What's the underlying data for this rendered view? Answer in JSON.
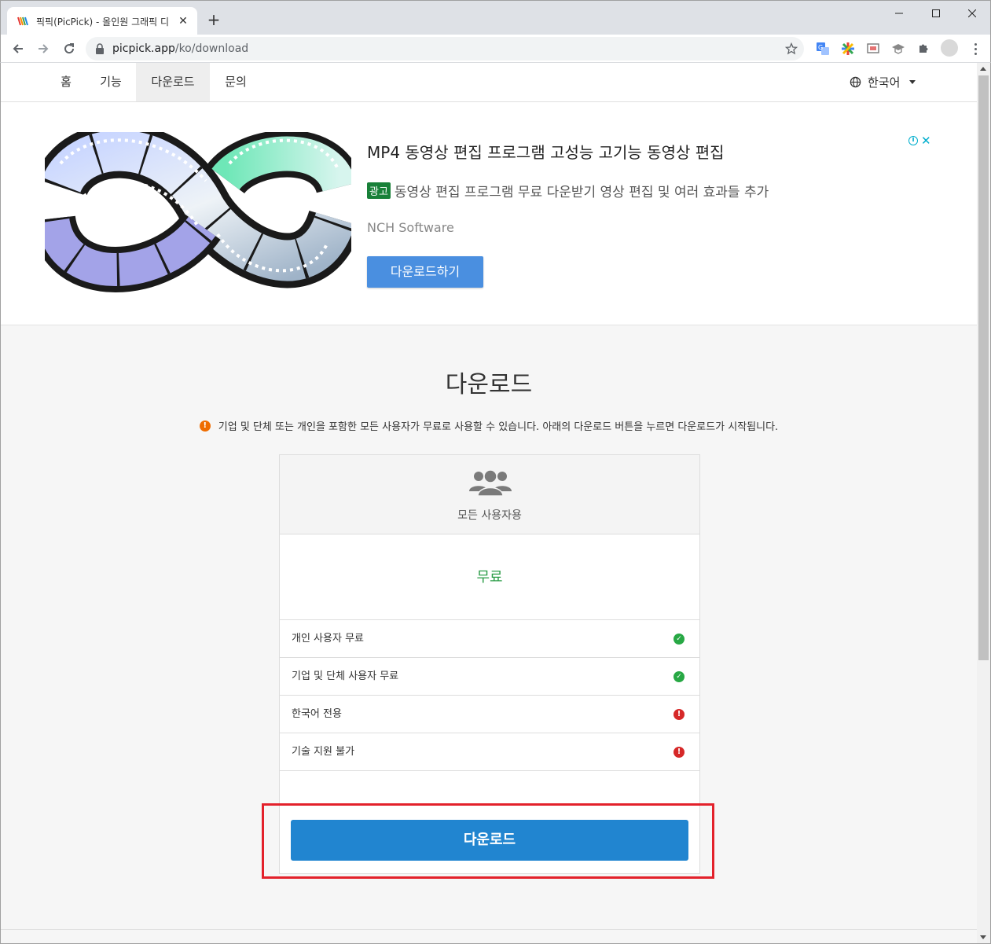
{
  "browser": {
    "tab_title": "픽픽(PicPick) - 올인원 그래픽 디",
    "url_host": "picpick.app",
    "url_path": "/ko/download"
  },
  "site_nav": {
    "items": [
      {
        "label": "홈"
      },
      {
        "label": "기능"
      },
      {
        "label": "다운로드"
      },
      {
        "label": "문의"
      }
    ],
    "language": "한국어"
  },
  "ad": {
    "title": "MP4 동영상 편집 프로그램 고성능 고기능 동영상 편집",
    "badge": "광고",
    "description": "동영상 편집 프로그램 무료 다운받기 영상 편집 및 여러 효과들 추가",
    "advertiser": "NCH Software",
    "button_label": "다운로드하기"
  },
  "download": {
    "title": "다운로드",
    "notice": "기업 및 단체 또는 개인을 포함한 모든 사용자가 무료로 사용할 수 있습니다. 아래의 다운로드 버튼을 누르면 다운로드가 시작됩니다.",
    "card": {
      "header_label": "모든 사용자용",
      "price": "무료",
      "features": [
        {
          "label": "개인 사용자 무료",
          "status": "ok"
        },
        {
          "label": "기업 및 단체 사용자 무료",
          "status": "ok"
        },
        {
          "label": "한국어 전용",
          "status": "error"
        },
        {
          "label": "기술 지원 불가",
          "status": "error"
        }
      ],
      "button_label": "다운로드"
    }
  },
  "colors": {
    "accent": "#2185d0",
    "price": "#2e9e4a",
    "highlight": "#e3212b"
  }
}
